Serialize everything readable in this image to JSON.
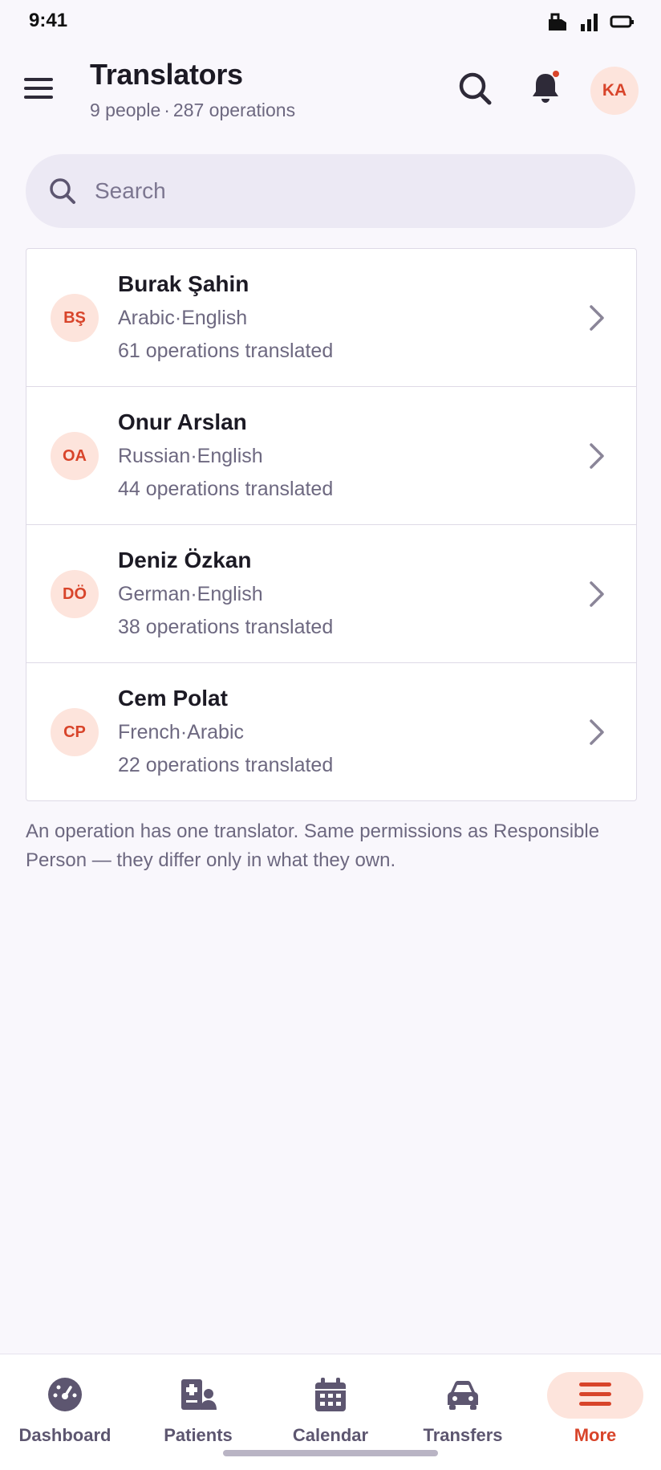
{
  "status_bar": {
    "time": "9:41"
  },
  "header": {
    "title": "Translators",
    "subtitle_people": "9 people",
    "subtitle_ops": "287 operations",
    "subtitle_separator": "·",
    "user_initials": "KA",
    "notification_dot_color": "#d8442a"
  },
  "search": {
    "placeholder": "Search",
    "value": ""
  },
  "translators": [
    {
      "initials": "BŞ",
      "name": "Burak Şahin",
      "lang1": "Arabic",
      "lang2": "English",
      "ops": "61 operations translated"
    },
    {
      "initials": "OA",
      "name": "Onur Arslan",
      "lang1": "Russian",
      "lang2": "English",
      "ops": "44 operations translated"
    },
    {
      "initials": "DÖ",
      "name": "Deniz Özkan",
      "lang1": "German",
      "lang2": "English",
      "ops": "38 operations translated"
    },
    {
      "initials": "CP",
      "name": "Cem Polat",
      "lang1": "French",
      "lang2": "Arabic",
      "ops": "22 operations translated"
    }
  ],
  "footnote": "An operation has one translator. Same permissions as Responsible Person — they differ only in what they own.",
  "bottom_nav": {
    "items": [
      {
        "label": "Dashboard",
        "icon": "dashboard-icon"
      },
      {
        "label": "Patients",
        "icon": "patients-icon"
      },
      {
        "label": "Calendar",
        "icon": "calendar-icon"
      },
      {
        "label": "Transfers",
        "icon": "car-icon"
      },
      {
        "label": "More",
        "icon": "menu-icon",
        "active": true
      }
    ]
  },
  "colors": {
    "accent": "#d8442a",
    "accent_soft": "#fde4dc",
    "background": "#f9f7fc",
    "muted_text": "#6d6880"
  }
}
